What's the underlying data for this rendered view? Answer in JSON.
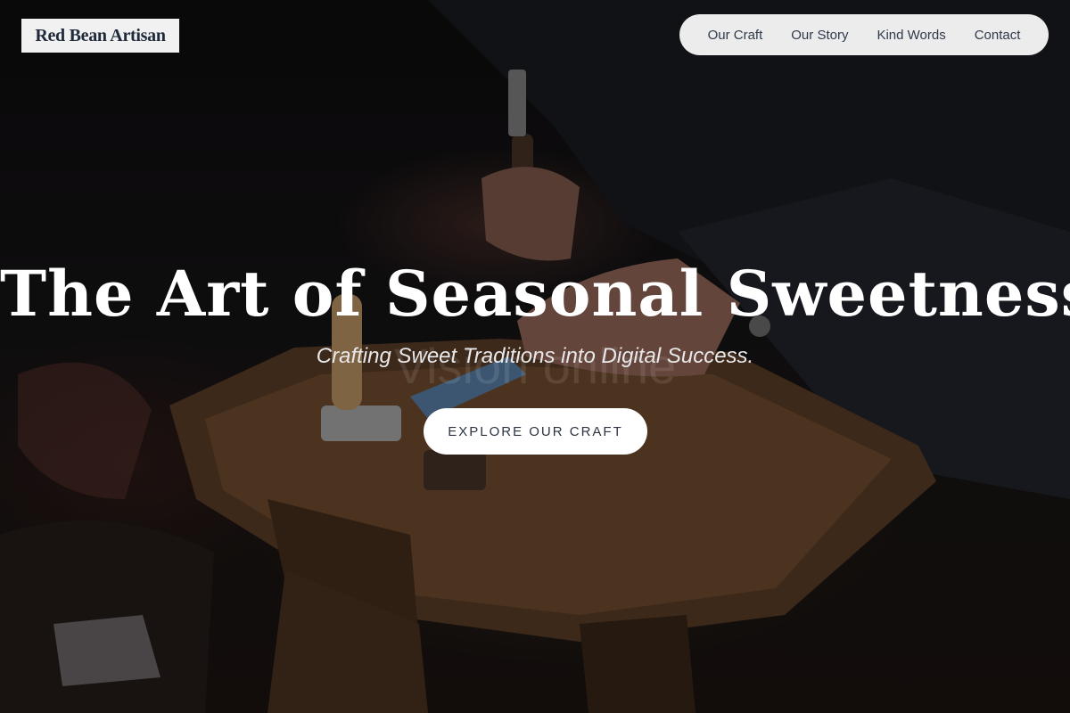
{
  "brand": {
    "name": "Red Bean Artisan"
  },
  "nav": {
    "items": [
      {
        "label": "Our Craft"
      },
      {
        "label": "Our Story"
      },
      {
        "label": "Kind Words"
      },
      {
        "label": "Contact"
      }
    ]
  },
  "hero": {
    "title": "The Art of Seasonal Sweetness",
    "subtitle": "Crafting Sweet Traditions into Digital Success.",
    "background_watermark": "Vision online",
    "cta_label": "EXPLORE OUR CRAFT"
  },
  "colors": {
    "nav_background": "#ececec",
    "brand_text": "#1f2a3a",
    "nav_text": "#2f3a4a",
    "cta_background": "#ffffff",
    "hero_text": "#ffffff"
  }
}
